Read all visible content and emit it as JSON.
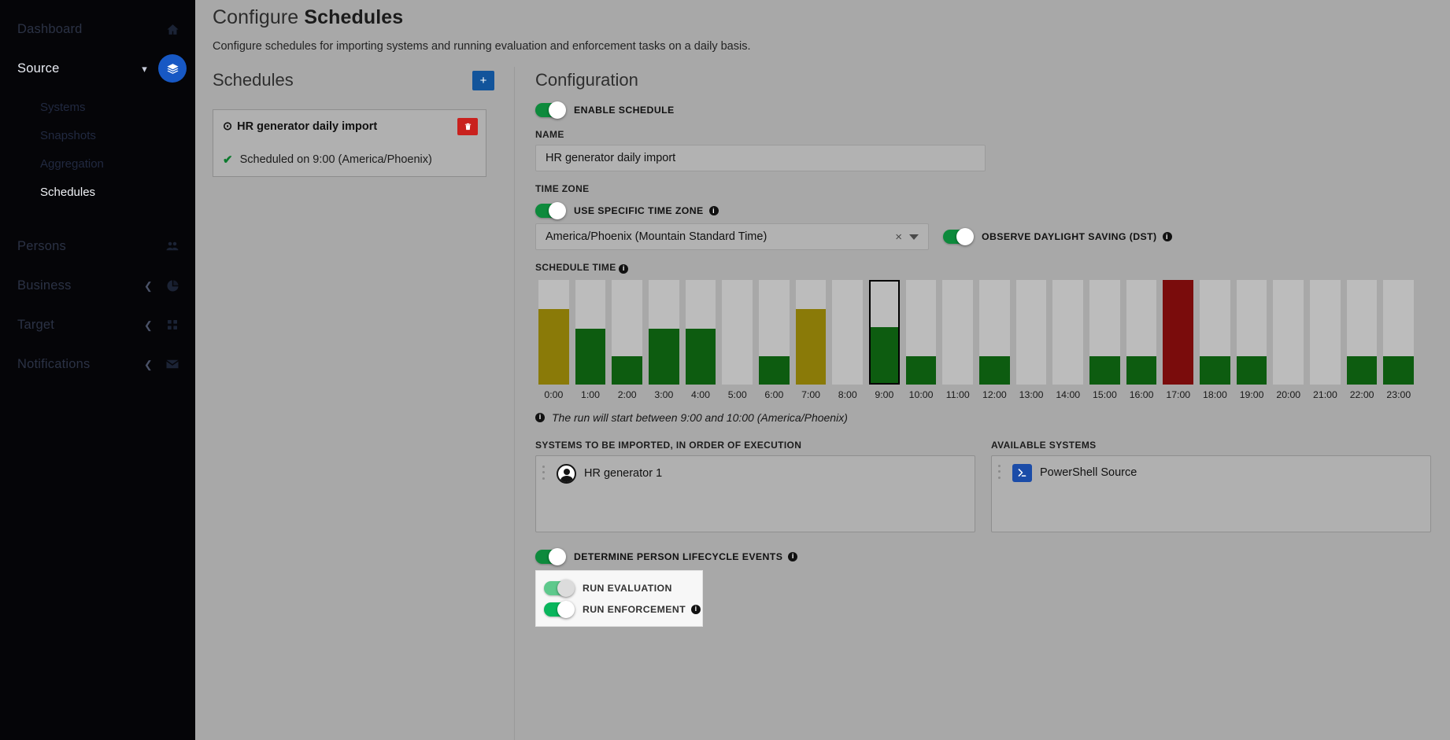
{
  "sidebar": {
    "items": [
      {
        "label": "Dashboard",
        "icon": "home-icon",
        "state": "dim"
      },
      {
        "label": "Source",
        "icon": "layers-icon",
        "state": "active"
      },
      {
        "label": "Persons",
        "icon": "people-icon",
        "state": "dim"
      },
      {
        "label": "Business",
        "icon": "pie-icon",
        "state": "dim"
      },
      {
        "label": "Target",
        "icon": "grid-icon",
        "state": "dim"
      },
      {
        "label": "Notifications",
        "icon": "mail-icon",
        "state": "dim"
      }
    ],
    "subitems": [
      {
        "label": "Systems",
        "selected": false
      },
      {
        "label": "Snapshots",
        "selected": false
      },
      {
        "label": "Aggregation",
        "selected": false
      },
      {
        "label": "Schedules",
        "selected": true
      }
    ]
  },
  "page": {
    "title_prefix": "Configure",
    "title_strong": "Schedules",
    "subtitle": "Configure schedules for importing systems and running evaluation and enforcement tasks on a daily basis."
  },
  "schedules_panel": {
    "heading": "Schedules",
    "add_label": "+",
    "card": {
      "clock_icon": "⊙",
      "name": "HR generator daily import",
      "delete_icon": "🗑",
      "status_check": "✔",
      "status": "Scheduled on 9:00 (America/Phoenix)"
    }
  },
  "configuration": {
    "heading": "Configuration",
    "enable_schedule": {
      "label": "ENABLE SCHEDULE",
      "on": true
    },
    "name_label": "NAME",
    "name_value": "HR generator daily import",
    "name_placeholder": "Name",
    "timezone_label": "TIME ZONE",
    "use_specific_tz": {
      "label": "USE SPECIFIC TIME ZONE",
      "on": true
    },
    "tz_value": "America/Phoenix (Mountain Standard Time)",
    "tz_clear": "×",
    "dst": {
      "label": "OBSERVE DAYLIGHT SAVING (DST)",
      "on": true
    },
    "schedule_time_label": "SCHEDULE TIME",
    "run_note": "The run will start between 9:00 and 10:00 (America/Phoenix)",
    "systems_imported_label": "SYSTEMS TO BE IMPORTED, IN ORDER OF EXECUTION",
    "available_systems_label": "AVAILABLE SYSTEMS",
    "imported_systems": [
      {
        "name": "HR generator 1",
        "icon": "person-avatar-icon"
      }
    ],
    "available_systems": [
      {
        "name": "PowerShell Source",
        "icon": "powershell-icon"
      }
    ],
    "lifecycle": {
      "label": "DETERMINE PERSON LIFECYCLE EVENTS",
      "on": true
    },
    "run_evaluation": {
      "label": "RUN EVALUATION",
      "on": true,
      "dimmed": true
    },
    "run_enforcement": {
      "label": "RUN ENFORCEMENT",
      "on": true,
      "dimmed": false
    }
  },
  "colors": {
    "accent_blue": "#12549b",
    "danger_red": "#c9211e",
    "toggle_green": "#0d8a3c",
    "bar_green": "#0d5c10",
    "bar_olive": "#8a7a08",
    "bar_darkred": "#7a0c0c",
    "bar_track": "#bcbcbc",
    "page_bg": "#a8a8a8",
    "sidebar_bg": "#050508"
  },
  "chart_data": {
    "type": "bar",
    "title": "SCHEDULE TIME",
    "xlabel": "",
    "ylabel": "",
    "ylim": [
      0,
      100
    ],
    "grid": false,
    "legend": "none",
    "categories": [
      "0:00",
      "1:00",
      "2:00",
      "3:00",
      "4:00",
      "5:00",
      "6:00",
      "7:00",
      "8:00",
      "9:00",
      "10:00",
      "11:00",
      "12:00",
      "13:00",
      "14:00",
      "15:00",
      "16:00",
      "17:00",
      "18:00",
      "19:00",
      "20:00",
      "21:00",
      "22:00",
      "23:00"
    ],
    "values": [
      72,
      53,
      27,
      53,
      53,
      0,
      27,
      72,
      0,
      55,
      27,
      0,
      27,
      0,
      0,
      27,
      27,
      100,
      27,
      27,
      0,
      0,
      27,
      27
    ],
    "bar_colors": [
      "#8a7a08",
      "#0d5c10",
      "#0d5c10",
      "#0d5c10",
      "#0d5c10",
      "none",
      "#0d5c10",
      "#8a7a08",
      "none",
      "#0d5c10",
      "#0d5c10",
      "none",
      "#0d5c10",
      "none",
      "none",
      "#0d5c10",
      "#0d5c10",
      "#7a0c0c",
      "#0d5c10",
      "#0d5c10",
      "none",
      "none",
      "#0d5c10",
      "#0d5c10"
    ],
    "selected_index": 9,
    "selected_category": "9:00",
    "notes": "Bar at 17:00 is dark red (full height); bars at 0:00 and 7:00 are olive; selected 9:00 bar is outlined in black."
  }
}
